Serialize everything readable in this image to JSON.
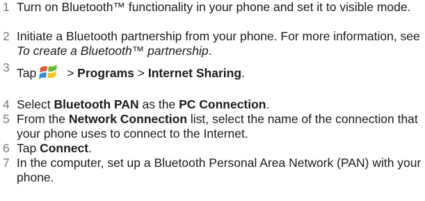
{
  "steps": [
    {
      "num": "1",
      "text": "Turn on Bluetooth™ functionality in your phone and set it to visible mode."
    },
    {
      "num": "2",
      "pre": "Initiate a Bluetooth partnership from your phone. For more information, see ",
      "link": "To create a Bluetooth™ partnership",
      "post": "."
    },
    {
      "num": "3",
      "tap": "Tap",
      "sep1": " > ",
      "programs": "Programs",
      "sep2": " > ",
      "sharing": "Internet Sharing",
      "end": ".",
      "icon": "windows-start-icon"
    },
    {
      "num": "4",
      "a": "Select ",
      "b": "Bluetooth PAN",
      "c": " as the ",
      "d": "PC Connection",
      "e": "."
    },
    {
      "num": "5",
      "a": "From the ",
      "b": "Network Connection",
      "c": " list, select the name of the connection that your phone uses to connect to the Internet."
    },
    {
      "num": "6",
      "a": "Tap ",
      "b": "Connect",
      "c": "."
    },
    {
      "num": "7",
      "text": "In the computer, set up a Bluetooth Personal Area Network (PAN) with your phone."
    }
  ]
}
